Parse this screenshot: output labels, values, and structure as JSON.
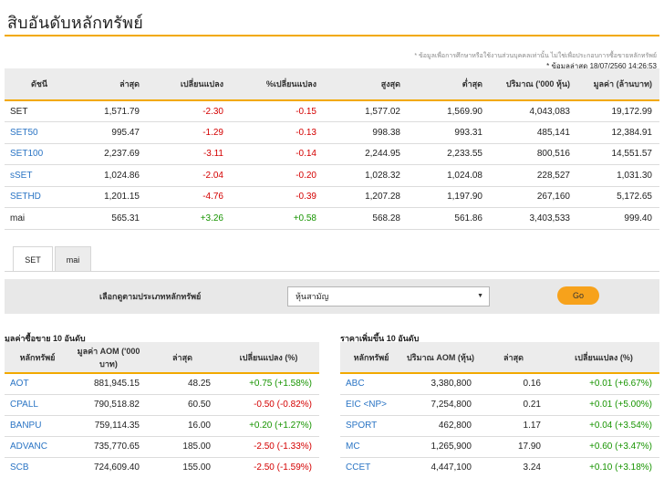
{
  "page_title": "สิบอันดับหลักทรัพย์",
  "notes": {
    "disclaimer": "* ข้อมูลเพื่อการศึกษาหรือใช้งานส่วนบุคคลเท่านั้น ไม่ใช่เพื่อประกอบการซื้อขายหลักทรัพย์",
    "updated": "* ข้อมูลล่าสุด 18/07/2560 14:26:53"
  },
  "index_table": {
    "headers": [
      "ดัชนี",
      "ล่าสุด",
      "เปลี่ยนแปลง",
      "%เปลี่ยนแปลง",
      "สูงสุด",
      "ต่ำสุด",
      "ปริมาณ ('000 หุ้น)",
      "มูลค่า (ล้านบาท)"
    ],
    "rows": [
      {
        "name": "SET",
        "last": "1,571.79",
        "change": "-2.30",
        "pct": "-0.15",
        "high": "1,577.02",
        "low": "1,569.90",
        "volume": "4,043,083",
        "value": "19,172.99",
        "trend": "neg",
        "link": false
      },
      {
        "name": "SET50",
        "last": "995.47",
        "change": "-1.29",
        "pct": "-0.13",
        "high": "998.38",
        "low": "993.31",
        "volume": "485,141",
        "value": "12,384.91",
        "trend": "neg",
        "link": true
      },
      {
        "name": "SET100",
        "last": "2,237.69",
        "change": "-3.11",
        "pct": "-0.14",
        "high": "2,244.95",
        "low": "2,233.55",
        "volume": "800,516",
        "value": "14,551.57",
        "trend": "neg",
        "link": true
      },
      {
        "name": "sSET",
        "last": "1,024.86",
        "change": "-2.04",
        "pct": "-0.20",
        "high": "1,028.32",
        "low": "1,024.08",
        "volume": "228,527",
        "value": "1,031.30",
        "trend": "neg",
        "link": true
      },
      {
        "name": "SETHD",
        "last": "1,201.15",
        "change": "-4.76",
        "pct": "-0.39",
        "high": "1,207.28",
        "low": "1,197.90",
        "volume": "267,160",
        "value": "5,172.65",
        "trend": "neg",
        "link": true
      },
      {
        "name": "mai",
        "last": "565.31",
        "change": "+3.26",
        "pct": "+0.58",
        "high": "568.28",
        "low": "561.86",
        "volume": "3,403,533",
        "value": "999.40",
        "trend": "pos",
        "link": false
      }
    ]
  },
  "tabs": [
    "SET",
    "mai"
  ],
  "filter": {
    "label": "เลือกดูตามประเภทหลักทรัพย์",
    "selected": "หุ้นสามัญ",
    "go_label": "Go"
  },
  "top_value": {
    "title": "มูลค่าซื้อขาย 10 อันดับ",
    "headers": [
      "หลักทรัพย์",
      "มูลค่า AOM ('000 บาท)",
      "ล่าสุด",
      "เปลี่ยนแปลง (%)"
    ],
    "rows": [
      {
        "symbol": "AOT",
        "aom": "881,945.15",
        "last": "48.25",
        "change": "+0.75 (+1.58%)",
        "trend": "pos"
      },
      {
        "symbol": "CPALL",
        "aom": "790,518.82",
        "last": "60.50",
        "change": "-0.50 (-0.82%)",
        "trend": "neg"
      },
      {
        "symbol": "BANPU",
        "aom": "759,114.35",
        "last": "16.00",
        "change": "+0.20 (+1.27%)",
        "trend": "pos"
      },
      {
        "symbol": "ADVANC",
        "aom": "735,770.65",
        "last": "185.00",
        "change": "-2.50 (-1.33%)",
        "trend": "neg"
      },
      {
        "symbol": "SCB",
        "aom": "724,609.40",
        "last": "155.00",
        "change": "-2.50 (-1.59%)",
        "trend": "neg"
      }
    ]
  },
  "top_gainers": {
    "title": "ราคาเพิ่มขึ้น 10 อันดับ",
    "headers": [
      "หลักทรัพย์",
      "ปริมาณ AOM (หุ้น)",
      "ล่าสุด",
      "เปลี่ยนแปลง (%)"
    ],
    "rows": [
      {
        "symbol": "ABC",
        "volume": "3,380,800",
        "last": "0.16",
        "change": "+0.01 (+6.67%)"
      },
      {
        "symbol": "EIC <NP>",
        "volume": "7,254,800",
        "last": "0.21",
        "change": "+0.01 (+5.00%)"
      },
      {
        "symbol": "SPORT",
        "volume": "462,800",
        "last": "1.17",
        "change": "+0.04 (+3.54%)"
      },
      {
        "symbol": "MC",
        "volume": "1,265,900",
        "last": "17.90",
        "change": "+0.60 (+3.47%)"
      },
      {
        "symbol": "CCET",
        "volume": "4,447,100",
        "last": "3.24",
        "change": "+0.10 (+3.18%)"
      }
    ]
  },
  "colors": {
    "accent": "#f2a900",
    "negative": "#d40000",
    "positive": "#179400",
    "link": "#2a74c4",
    "button": "#f7a21b"
  }
}
